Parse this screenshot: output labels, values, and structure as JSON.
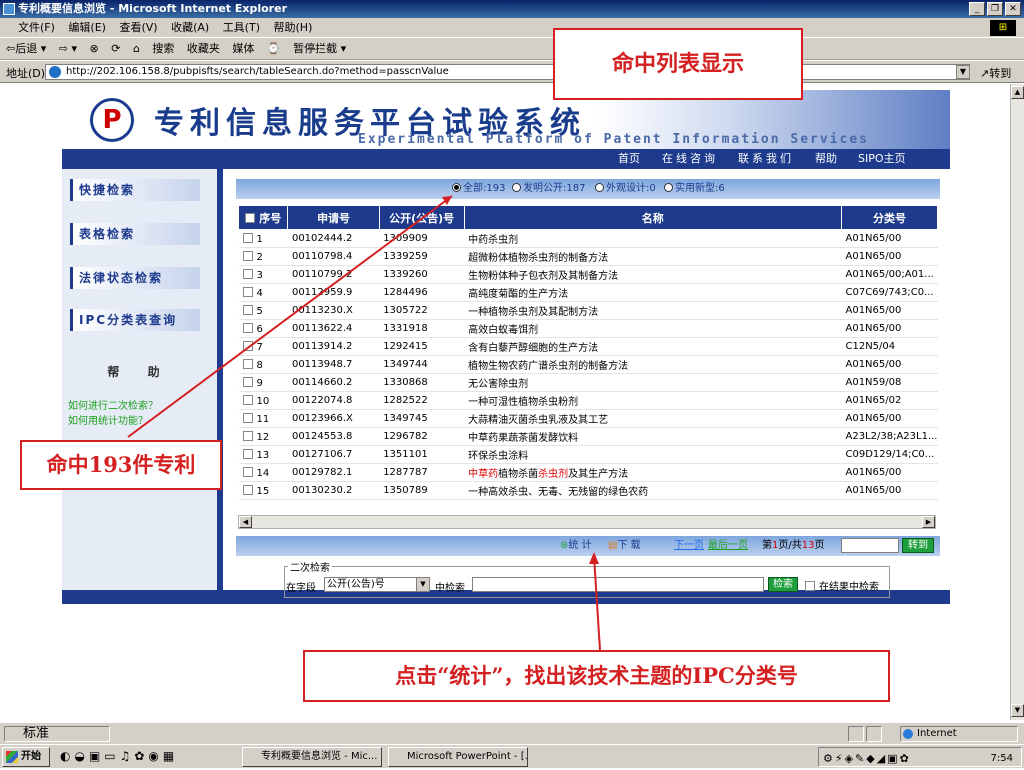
{
  "window": {
    "title": "专利概要信息浏览 - Microsoft Internet Explorer"
  },
  "menu": [
    "文件(F)",
    "编辑(E)",
    "查看(V)",
    "收藏(A)",
    "工具(T)",
    "帮助(H)"
  ],
  "toolbar": [
    "⇦后退 ▾",
    "⇨ ▾",
    "⊗",
    "⟳",
    "⌂",
    "搜索",
    "收藏夹",
    "媒体",
    "⌚",
    "暂停拦截 ▾"
  ],
  "address": {
    "label": "地址(D)",
    "url": "http://202.106.158.8/pubpisfts/search/tableSearch.do?method=passcnValue",
    "go": "转到"
  },
  "site": {
    "title": "专利信息服务平台试验系统",
    "subtitle": "Experimental Platform of Patent Information Services",
    "logo": "P",
    "nav": [
      "首页",
      "在线咨询",
      "联系我们",
      "帮助",
      "SIPO主页"
    ]
  },
  "sidebar": {
    "items": [
      "快捷检索",
      "表格检索",
      "法律状态检索",
      "IPC分类表查询"
    ],
    "help_title": "帮 助",
    "help_links": [
      "如何进行二次检索？",
      "如何用统计功能？"
    ]
  },
  "filters": [
    {
      "label": "全部:193",
      "selected": true
    },
    {
      "label": "发明公开:187",
      "selected": false
    },
    {
      "label": "外观设计:0",
      "selected": false
    },
    {
      "label": "实用新型:6",
      "selected": false
    }
  ],
  "table": {
    "headers": [
      "序号",
      "申请号",
      "公开(公告)号",
      "名称",
      "分类号"
    ],
    "rows": [
      {
        "no": "1",
        "app": "00102444.2",
        "pub": "1309909",
        "name": "中药杀虫剂",
        "ipc": "A01N65/00"
      },
      {
        "no": "2",
        "app": "00110798.4",
        "pub": "1339259",
        "name": "超微粉体植物杀虫剂的制备方法",
        "ipc": "A01N65/00"
      },
      {
        "no": "3",
        "app": "00110799.2",
        "pub": "1339260",
        "name": "生物粉体种子包衣剂及其制备方法",
        "ipc": "A01N65/00;A01..."
      },
      {
        "no": "4",
        "app": "00112959.9",
        "pub": "1284496",
        "name": "高纯度菊酯的生产方法",
        "ipc": "C07C69/743;C0..."
      },
      {
        "no": "5",
        "app": "00113230.X",
        "pub": "1305722",
        "name": "一种植物杀虫剂及其配制方法",
        "ipc": "A01N65/00"
      },
      {
        "no": "6",
        "app": "00113622.4",
        "pub": "1331918",
        "name": "高效白蚁毒饵剂",
        "ipc": "A01N65/00"
      },
      {
        "no": "7",
        "app": "00113914.2",
        "pub": "1292415",
        "name": "含有白藜芦醇细胞的生产方法",
        "ipc": "C12N5/04"
      },
      {
        "no": "8",
        "app": "00113948.7",
        "pub": "1349744",
        "name": "植物生物农药广谱杀虫剂的制备方法",
        "ipc": "A01N65/00"
      },
      {
        "no": "9",
        "app": "00114660.2",
        "pub": "1330868",
        "name": "无公害除虫剂",
        "ipc": "A01N59/08"
      },
      {
        "no": "10",
        "app": "00122074.8",
        "pub": "1282522",
        "name": "一种可湿性植物杀虫粉剂",
        "ipc": "A01N65/02"
      },
      {
        "no": "11",
        "app": "00123966.X",
        "pub": "1349745",
        "name": "大蒜精油灭菌杀虫乳液及其工艺",
        "ipc": "A01N65/00"
      },
      {
        "no": "12",
        "app": "00124553.8",
        "pub": "1296782",
        "name": "中草药果蔬茶菌发酵饮料",
        "ipc": "A23L2/38;A23L1..."
      },
      {
        "no": "13",
        "app": "00127106.7",
        "pub": "1351101",
        "name": "环保杀虫涂料",
        "ipc": "C09D129/14;C0..."
      },
      {
        "no": "14",
        "app": "00129782.1",
        "pub": "1287787",
        "name_pre": "中草药",
        "name_mid": "植物杀菌",
        "name_hl": "杀虫剂",
        "name_post": "及其生产方法",
        "ipc": "A01N65/00"
      },
      {
        "no": "15",
        "app": "00130230.2",
        "pub": "1350789",
        "name": "一种高效杀虫、无毒、无残留的绿色农药",
        "ipc": "A01N65/00"
      }
    ]
  },
  "stats": {
    "stat": "统 计",
    "download": "下 载",
    "next": "下一页",
    "last": "最后一页",
    "page_prefix": "第",
    "page": "1",
    "page_mid": "页/共",
    "total": "13",
    "page_suffix": "页",
    "go": "转到"
  },
  "secondary": {
    "legend": "二次检索",
    "field_label": "在字段",
    "field_value": "公开(公告)号",
    "in_label": "中检索",
    "search": "检索",
    "in_results": "在结果中检索"
  },
  "annotations": {
    "top": "命中列表显示",
    "left": "命中193件专利",
    "bottom": "点击“统计”，找出该技术主题的IPC分类号",
    "color": "#d42020"
  },
  "status": {
    "ready": "标准",
    "zone": "Internet"
  },
  "taskbar": {
    "start": "开始",
    "items": [
      "专利概要信息浏览 - Mic...",
      "Microsoft PowerPoint - [..."
    ],
    "time": "7:54"
  }
}
